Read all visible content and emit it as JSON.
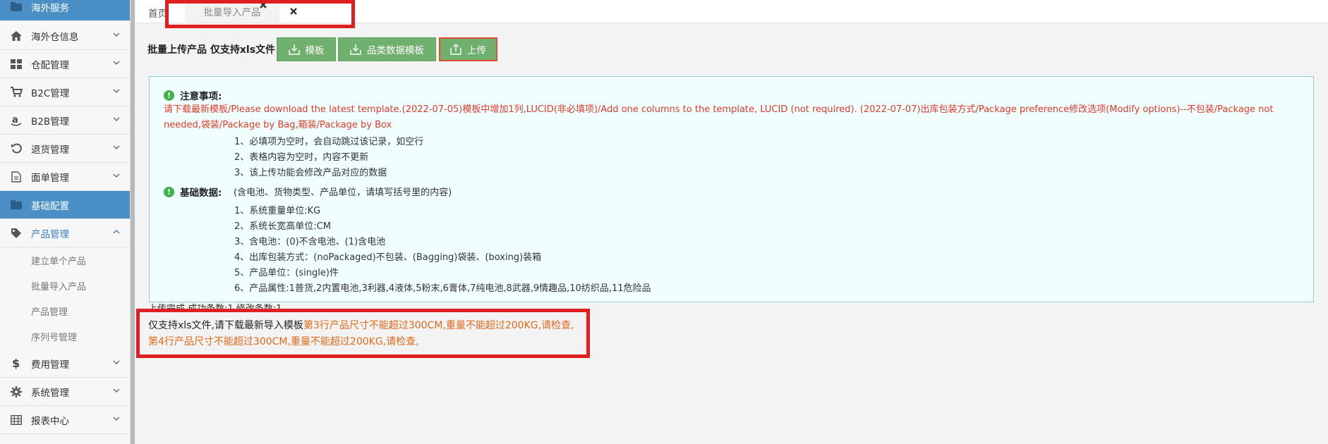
{
  "sidebar": {
    "items": [
      {
        "label": "海外服务",
        "icon": "folder-icon"
      },
      {
        "label": "海外仓信息",
        "icon": "home-icon"
      },
      {
        "label": "仓配管理",
        "icon": "grid-icon"
      },
      {
        "label": "B2C管理",
        "icon": "cart-icon"
      },
      {
        "label": "B2B管理",
        "icon": "amazon-icon"
      },
      {
        "label": "退货管理",
        "icon": "undo-icon"
      },
      {
        "label": "面单管理",
        "icon": "document-icon"
      },
      {
        "label": "基础配置",
        "icon": "folder-icon"
      },
      {
        "label": "产品管理",
        "icon": "tag-icon"
      },
      {
        "label": "费用管理",
        "icon": "dollar-icon"
      },
      {
        "label": "系统管理",
        "icon": "gear-icon"
      },
      {
        "label": "报表中心",
        "icon": "table-icon"
      }
    ],
    "sub_items": [
      "建立单个产品",
      "批量导入产品",
      "产品管理",
      "序列号管理"
    ]
  },
  "tabs": {
    "home": "首页",
    "active": "批量导入产品"
  },
  "toolbar": {
    "label": "批量上传产品 仅支持xls文件",
    "template_btn": "模板",
    "category_btn": "品类数据模板",
    "upload_btn": "上传"
  },
  "notice": {
    "title": "注意事项:",
    "red_text": "请下载最新模板/Please download the latest template.(2022-07-05)模板中增加1列,LUCID(非必填项)/Add one columns to the template, LUCID (not required). (2022-07-07)出库包装方式/Package preference修改选项(Modify options)--不包装/Package not needed,袋装/Package by Bag,箱装/Package by Box",
    "items": [
      "1、必填项为空时，会自动跳过该记录，如空行",
      "2、表格内容为空时，内容不更新",
      "3、该上传功能会修改产品对应的数据"
    ],
    "basic_title": "基础数据:",
    "basic_note": "(含电池、货物类型、产品单位，请填写括号里的内容)",
    "basic_items": [
      "1、系统重量单位:KG",
      "2、系统长宽高单位:CM",
      "3、含电池：(0)不含电池、(1)含电池",
      "4、出库包装方式：(noPackaged)不包装、(Bagging)袋装、(boxing)装箱",
      "5、产品单位：(single)件",
      "6、产品属性:1普货,2内置电池,3利器,4液体,5粉末,6膏体,7纯电池,8武器,9情趣品,10纺织品,11危险品"
    ]
  },
  "result": {
    "hidden_line": "上传完成,成功条数:1,修改条数:1",
    "prefix": "仅支持xls文件,请下载最新导入模板",
    "error1": "第3行产品尺寸不能超过300CM,重量不能超过200KG,请检查,",
    "error2": "第4行产品尺寸不能超过300CM,重量不能超过200KG,请检查,"
  }
}
